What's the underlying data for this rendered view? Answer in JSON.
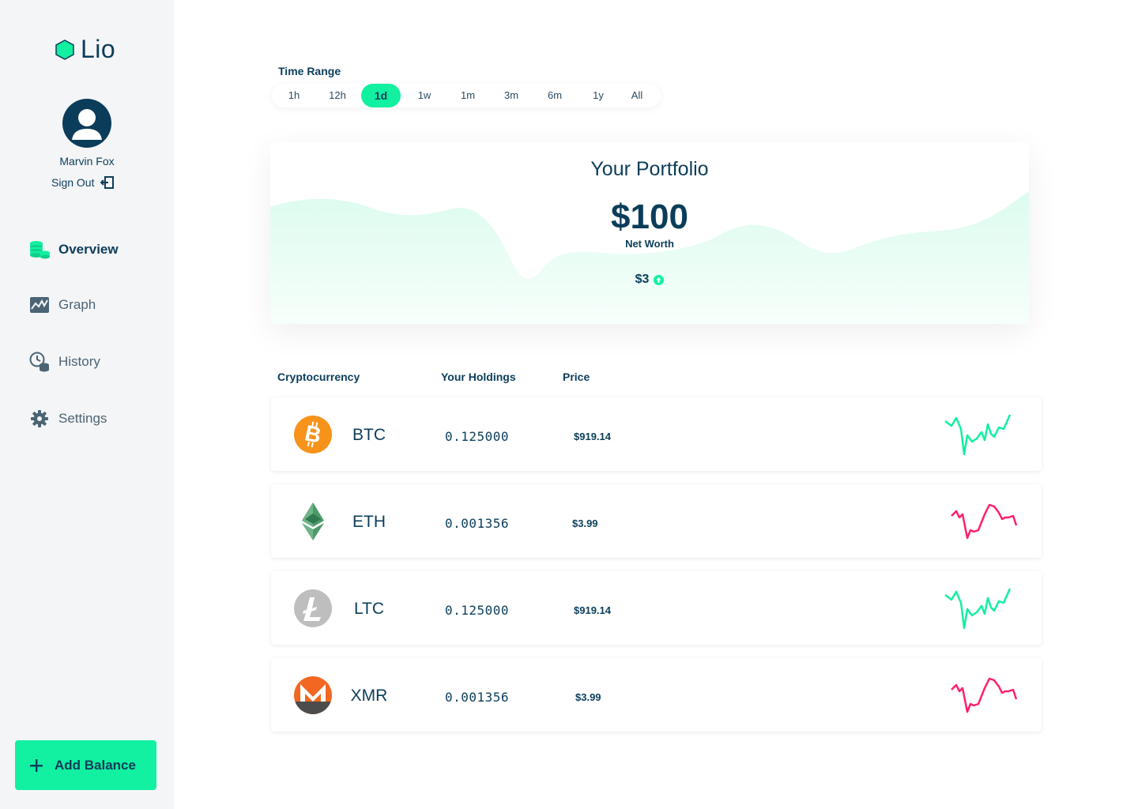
{
  "app": {
    "name": "Lio",
    "accent": "#12f0a1",
    "primary": "#0b3d5a"
  },
  "user": {
    "name": "Marvin Fox",
    "signout_label": "Sign Out"
  },
  "nav": [
    {
      "label": "Overview",
      "icon": "coins-stack-icon",
      "active": true
    },
    {
      "label": "Graph",
      "icon": "chart-icon",
      "active": false
    },
    {
      "label": "History",
      "icon": "coins-history-icon",
      "active": false
    },
    {
      "label": "Settings",
      "icon": "gear-icon",
      "active": false
    }
  ],
  "add_balance": {
    "label": "Add Balance",
    "icon": "plus-icon"
  },
  "time_range": {
    "label": "Time Range",
    "options": [
      "1h",
      "12h",
      "1d",
      "1w",
      "1m",
      "3m",
      "6m",
      "1y",
      "All"
    ],
    "selected": "1d"
  },
  "portfolio": {
    "title": "Your Portfolio",
    "value": "$100",
    "subtitle": "Net Worth",
    "change": "$3",
    "change_direction": "up",
    "change_icon": "arrow-up-circle-icon"
  },
  "table": {
    "headers": [
      "Cryptocurrency",
      "Your Holdings",
      "Price"
    ],
    "rows": [
      {
        "symbol": "BTC",
        "holdings": "0.125000",
        "price": "$919.14",
        "icon": "bitcoin-icon",
        "trend": "up",
        "trend_color": "#12f0a1"
      },
      {
        "symbol": "ETH",
        "holdings": "0.001356",
        "price": "$3.99",
        "icon": "ethereum-icon",
        "trend": "down",
        "trend_color": "#ff1f6a"
      },
      {
        "symbol": "LTC",
        "holdings": "0.125000",
        "price": "$919.14",
        "icon": "litecoin-icon",
        "trend": "up",
        "trend_color": "#12f0a1"
      },
      {
        "symbol": "XMR",
        "holdings": "0.001356",
        "price": "$3.99",
        "icon": "monero-icon",
        "trend": "down",
        "trend_color": "#ff1f6a"
      }
    ]
  }
}
